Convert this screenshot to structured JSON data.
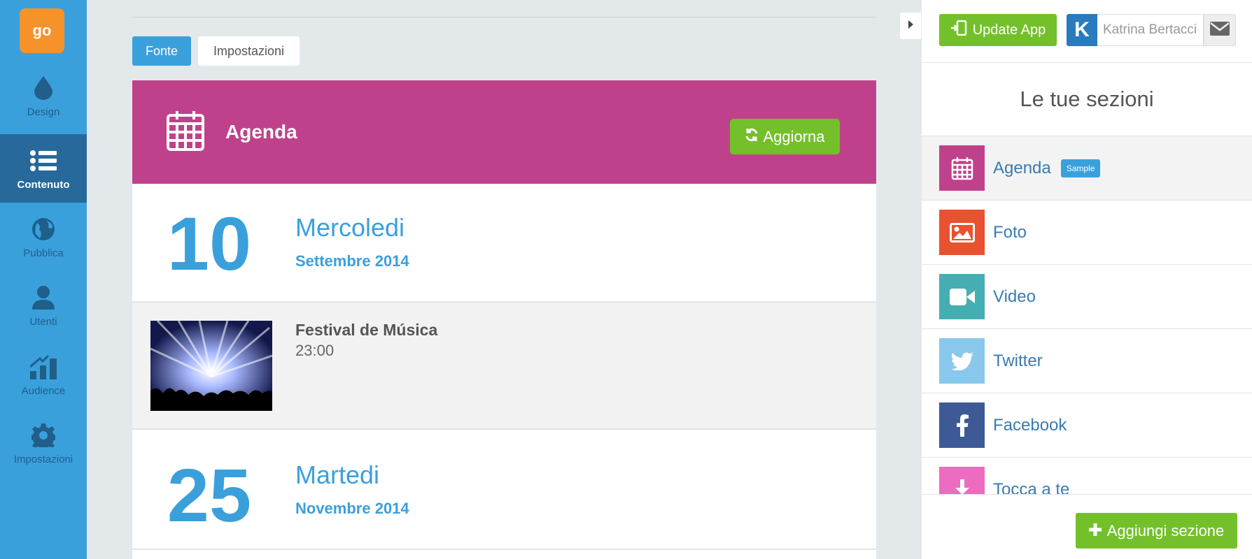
{
  "sidebar": {
    "logo_text": "go",
    "items": [
      {
        "label": "Design",
        "icon": "drop-icon"
      },
      {
        "label": "Contenuto",
        "icon": "list-icon"
      },
      {
        "label": "Pubblica",
        "icon": "globe-icon"
      },
      {
        "label": "Utenti",
        "icon": "user-icon"
      },
      {
        "label": "Audience",
        "icon": "bar-chart-icon"
      },
      {
        "label": "Impostazioni",
        "icon": "gear-icon"
      }
    ]
  },
  "tabs": {
    "fonte": "Fonte",
    "impostazioni": "Impostazioni"
  },
  "agenda": {
    "title": "Agenda",
    "refresh_label": "Aggiorna",
    "days": [
      {
        "day": "10",
        "weekday": "Mercoledi",
        "month": "Settembre 2014"
      },
      {
        "day": "25",
        "weekday": "Martedi",
        "month": "Novembre 2014"
      }
    ],
    "events": [
      {
        "title": "Festival de Música",
        "time": "23:00"
      }
    ]
  },
  "topbar": {
    "update_label": "Update App",
    "user_initial": "K",
    "user_name": "Katrina Bertacci"
  },
  "sections": {
    "title": "Le tue sezioni",
    "items": [
      {
        "label": "Agenda",
        "badge": "Sample",
        "color": "#c0418b",
        "icon": "calendar-icon"
      },
      {
        "label": "Foto",
        "color": "#e8522e",
        "icon": "image-icon"
      },
      {
        "label": "Video",
        "color": "#45aeb3",
        "icon": "video-icon"
      },
      {
        "label": "Twitter",
        "color": "#88c8ec",
        "icon": "twitter-icon"
      },
      {
        "label": "Facebook",
        "color": "#3e5a96",
        "icon": "facebook-icon"
      },
      {
        "label": "Tocca a te",
        "color": "#ec6cc0",
        "icon": "download-icon"
      }
    ],
    "add_label": "Aggiungi sezione"
  }
}
